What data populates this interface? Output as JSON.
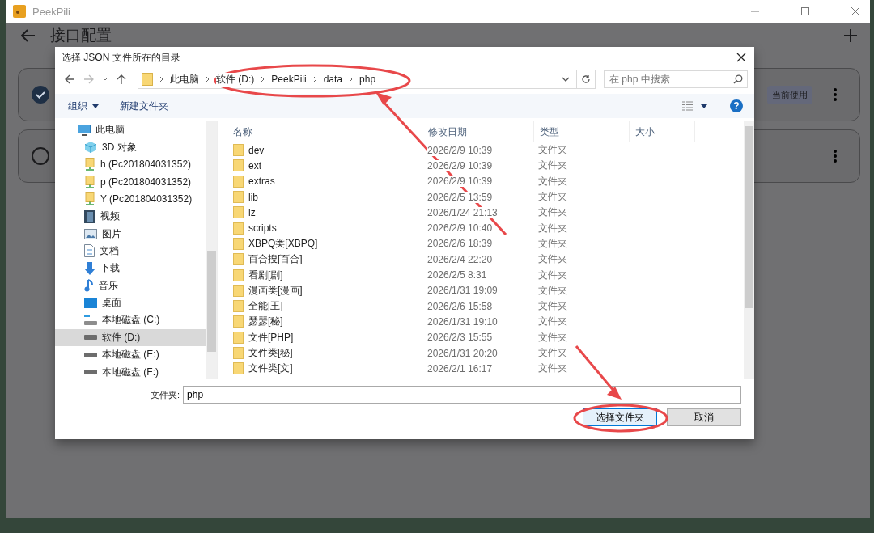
{
  "app_window": {
    "title": "PeekPili",
    "page_title": "接口配置",
    "cards": [
      {
        "selected": true,
        "badge": "当前使用"
      },
      {
        "selected": false
      }
    ]
  },
  "dialog": {
    "title": "选择 JSON 文件所在的目录",
    "breadcrumb": [
      "此电脑",
      "软件 (D:)",
      "PeekPili",
      "data",
      "php"
    ],
    "search": {
      "placeholder": "在 php 中搜索"
    },
    "toolbar": [
      "组织",
      "新建文件夹"
    ],
    "help_button": "?",
    "nav_items": [
      {
        "label": "此电脑",
        "kind": "pc",
        "selected": false,
        "children": [
          {
            "label": "3D 对象",
            "kind": "cube",
            "selected": false
          },
          {
            "label": "h (Pc201804031352)",
            "kind": "netdrive",
            "selected": false
          },
          {
            "label": "p (Pc201804031352)",
            "kind": "netdrive",
            "selected": false
          },
          {
            "label": "Y (Pc201804031352)",
            "kind": "netdrive",
            "selected": false
          },
          {
            "label": "视频",
            "kind": "video",
            "selected": false
          },
          {
            "label": "图片",
            "kind": "picture",
            "selected": false
          },
          {
            "label": "文档",
            "kind": "document",
            "selected": false
          },
          {
            "label": "下载",
            "kind": "download",
            "selected": false
          },
          {
            "label": "音乐",
            "kind": "music",
            "selected": false
          },
          {
            "label": "桌面",
            "kind": "desktop",
            "selected": false
          },
          {
            "label": "本地磁盘 (C:)",
            "kind": "sysdrive",
            "selected": false
          },
          {
            "label": "软件 (D:)",
            "kind": "drive",
            "selected": true
          },
          {
            "label": "本地磁盘 (E:)",
            "kind": "drive",
            "selected": false
          },
          {
            "label": "本地磁盘 (F:)",
            "kind": "drive",
            "selected": false
          }
        ]
      }
    ],
    "columns": [
      "名称",
      "修改日期",
      "类型",
      "大小"
    ],
    "files": [
      {
        "name": "dev",
        "modified": "2026/2/9 10:39",
        "type": "文件夹"
      },
      {
        "name": "ext",
        "modified": "2026/2/9 10:39",
        "type": "文件夹"
      },
      {
        "name": "extras",
        "modified": "2026/2/9 10:39",
        "type": "文件夹"
      },
      {
        "name": "lib",
        "modified": "2026/2/5 13:59",
        "type": "文件夹"
      },
      {
        "name": "lz",
        "modified": "2026/1/24 21:13",
        "type": "文件夹"
      },
      {
        "name": "scripts",
        "modified": "2026/2/9 10:40",
        "type": "文件夹"
      },
      {
        "name": "XBPQ类[XBPQ]",
        "modified": "2026/2/6 18:39",
        "type": "文件夹"
      },
      {
        "name": "百合搜[百合]",
        "modified": "2026/2/4 22:20",
        "type": "文件夹"
      },
      {
        "name": "看剧[剧]",
        "modified": "2026/2/5 8:31",
        "type": "文件夹"
      },
      {
        "name": "漫画类[漫画]",
        "modified": "2026/1/31 19:09",
        "type": "文件夹"
      },
      {
        "name": "全能[王]",
        "modified": "2026/2/6 15:58",
        "type": "文件夹"
      },
      {
        "name": "瑟瑟[秘]",
        "modified": "2026/1/31 19:10",
        "type": "文件夹"
      },
      {
        "name": "文件[PHP]",
        "modified": "2026/2/3 15:55",
        "type": "文件夹"
      },
      {
        "name": "文件类[秘]",
        "modified": "2026/1/31 20:20",
        "type": "文件夹"
      },
      {
        "name": "文件类[文]",
        "modified": "2026/2/1 16:17",
        "type": "文件夹"
      }
    ],
    "folder_field": {
      "label": "文件夹:",
      "value": "php"
    },
    "buttons": [
      {
        "label": "选择文件夹",
        "kind": "primary"
      },
      {
        "label": "取消",
        "kind": "secondary"
      }
    ]
  }
}
